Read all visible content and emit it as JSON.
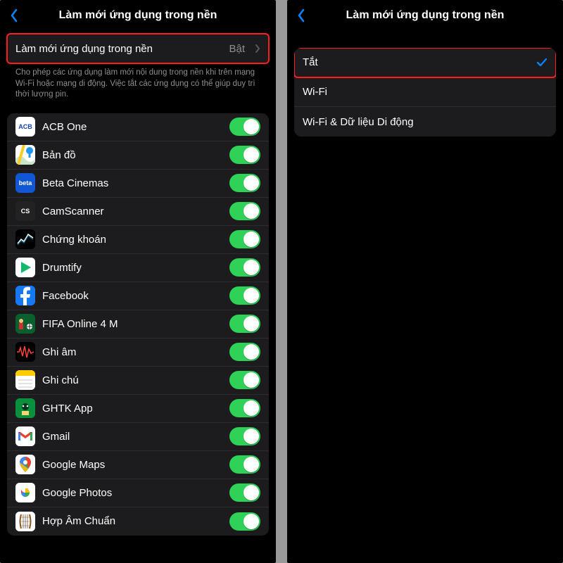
{
  "left": {
    "title": "Làm mới ứng dụng trong nền",
    "mainRow": {
      "label": "Làm mới ứng dụng trong nền",
      "value": "Bật"
    },
    "footnote": "Cho phép các ứng dụng làm mới nội dung trong nền khi trên mạng Wi-Fi hoặc mạng di động. Việc tắt các ứng dụng có thể giúp duy trì thời lượng pin.",
    "apps": [
      {
        "name": "ACB One",
        "icon": "acb",
        "bg": "#ffffff",
        "fg": "#1445b3",
        "txt": "ACB"
      },
      {
        "name": "Bản đồ",
        "icon": "maps",
        "bg": "#ffffff"
      },
      {
        "name": "Beta Cinemas",
        "icon": "beta",
        "bg": "#1156d4",
        "fg": "#fff",
        "txt": "beta"
      },
      {
        "name": "CamScanner",
        "icon": "cs",
        "bg": "#222222",
        "fg": "#fff",
        "txt": "CS"
      },
      {
        "name": "Chứng khoán",
        "icon": "stocks",
        "bg": "#000000"
      },
      {
        "name": "Drumtify",
        "icon": "drumtify",
        "bg": "#ffffff"
      },
      {
        "name": "Facebook",
        "icon": "fb",
        "bg": "#1877f2"
      },
      {
        "name": "FIFA Online 4 M",
        "icon": "fifa",
        "bg": "#0a5f2f"
      },
      {
        "name": "Ghi âm",
        "icon": "voice",
        "bg": "#000000"
      },
      {
        "name": "Ghi chú",
        "icon": "notes",
        "bg": "#ffffff"
      },
      {
        "name": "GHTK App",
        "icon": "ghtk",
        "bg": "#0a8f3c"
      },
      {
        "name": "Gmail",
        "icon": "gmail",
        "bg": "#ffffff"
      },
      {
        "name": "Google Maps",
        "icon": "gmaps",
        "bg": "#ffffff"
      },
      {
        "name": "Google Photos",
        "icon": "gphotos",
        "bg": "#ffffff"
      },
      {
        "name": "Hợp Âm Chuẩn",
        "icon": "hac",
        "bg": "#ffffff"
      }
    ]
  },
  "right": {
    "title": "Làm mới ứng dụng trong nền",
    "options": [
      {
        "label": "Tắt",
        "selected": true
      },
      {
        "label": "Wi-Fi",
        "selected": false
      },
      {
        "label": "Wi-Fi & Dữ liệu Di động",
        "selected": false
      }
    ]
  }
}
